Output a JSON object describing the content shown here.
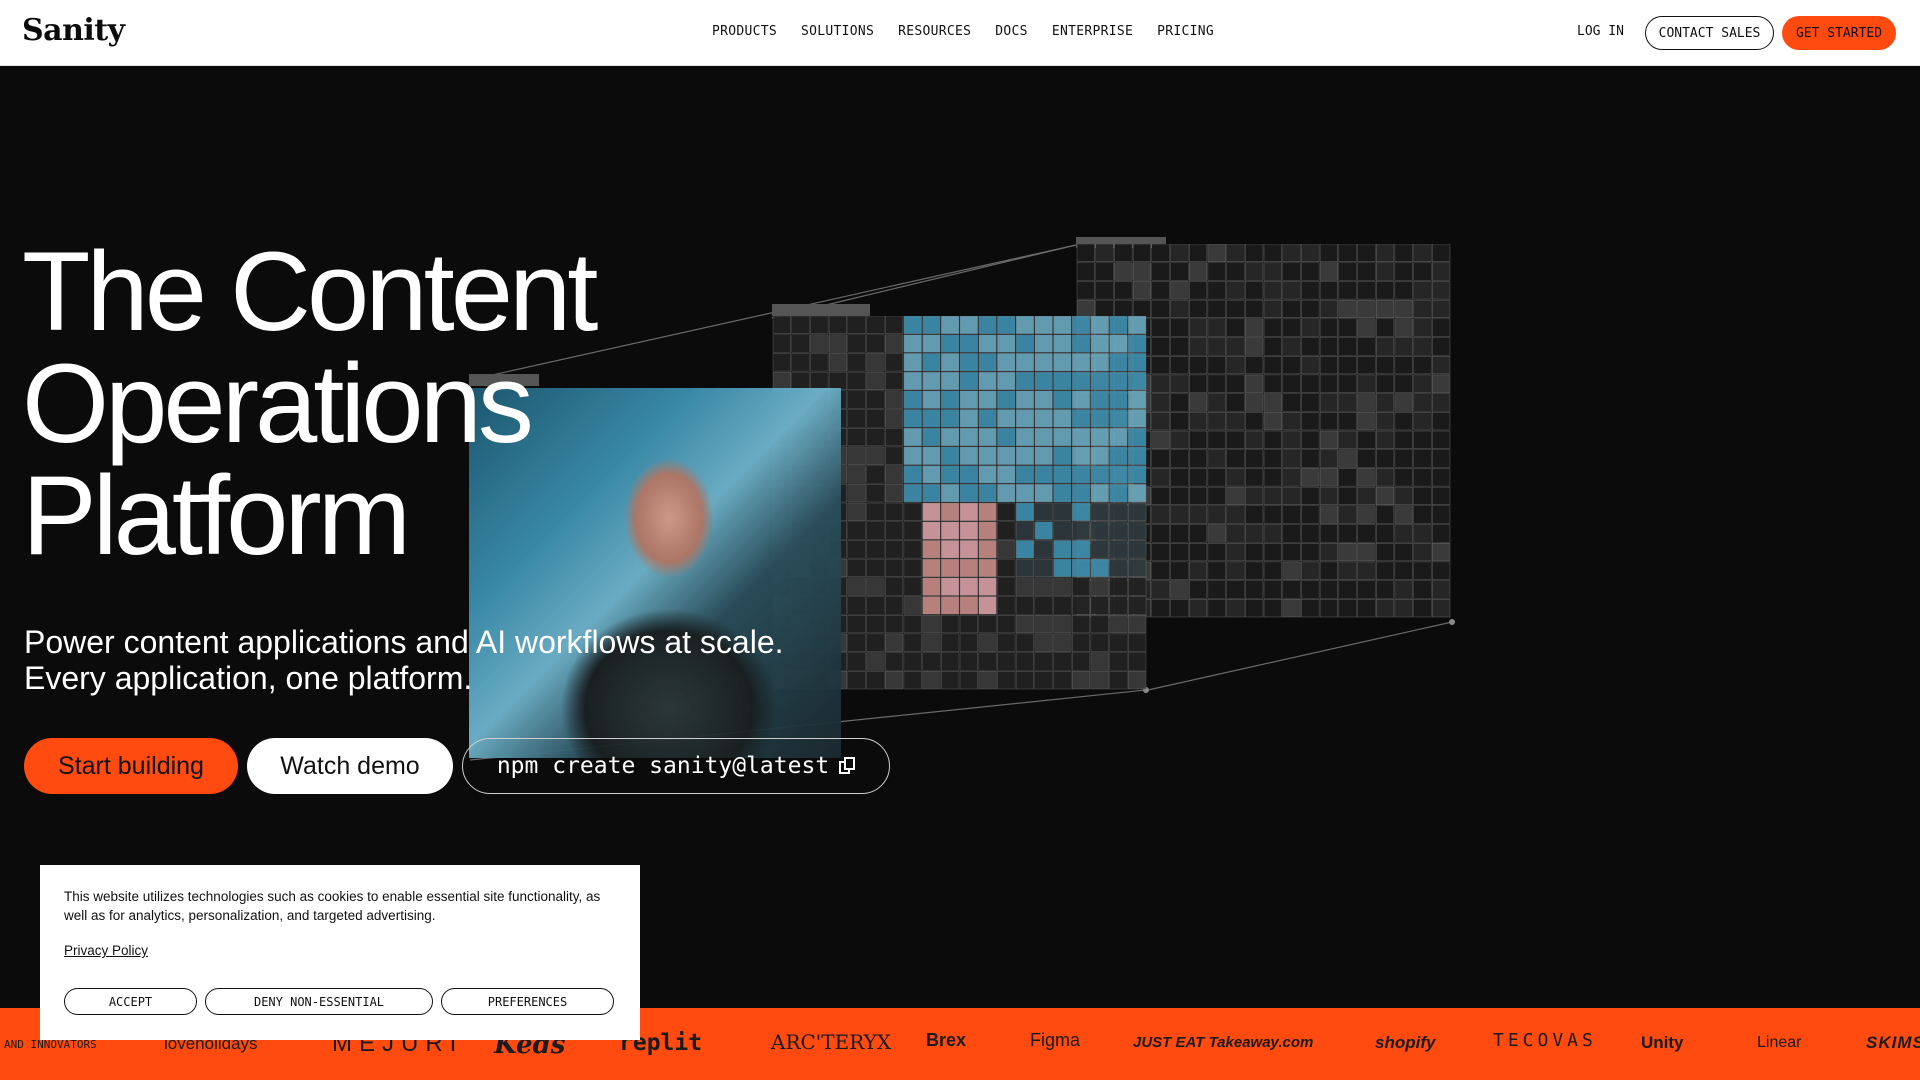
{
  "nav": {
    "logo": "Sanity",
    "links": [
      "PRODUCTS",
      "SOLUTIONS",
      "RESOURCES",
      "DOCS",
      "ENTERPRISE",
      "PRICING"
    ],
    "login": "LOG IN",
    "contact": "CONTACT SALES",
    "get_started": "GET STARTED"
  },
  "hero": {
    "title_lines": [
      "The Content",
      "Operations",
      "Platform"
    ],
    "subtitle_lines": [
      "Power content applications and AI workflows at scale.",
      "Every application, one platform."
    ],
    "cta_primary": "Start building",
    "cta_secondary": "Watch demo",
    "npm_command": "npm create sanity@latest"
  },
  "cookie": {
    "text": "This website utilizes technologies such as cookies to enable essential site functionality, as well as for analytics, personalization, and targeted advertising.",
    "privacy": "Privacy Policy",
    "accept": "ACCEPT",
    "deny": "DENY NON-ESSENTIAL",
    "preferences": "PREFERENCES"
  },
  "strip": {
    "label": "AND INNOVATORS",
    "brands": [
      "loveholidays",
      "MEJURI",
      "Keds",
      "replit",
      "ARC'TERYX",
      "Brex",
      "Figma",
      "JUST EAT Takeaway.com",
      "shopify",
      "TECOVAS",
      "Unity",
      "Linear",
      "SKIMS"
    ]
  },
  "colors": {
    "accent": "#ff4a10",
    "background": "#0b0b0b"
  }
}
